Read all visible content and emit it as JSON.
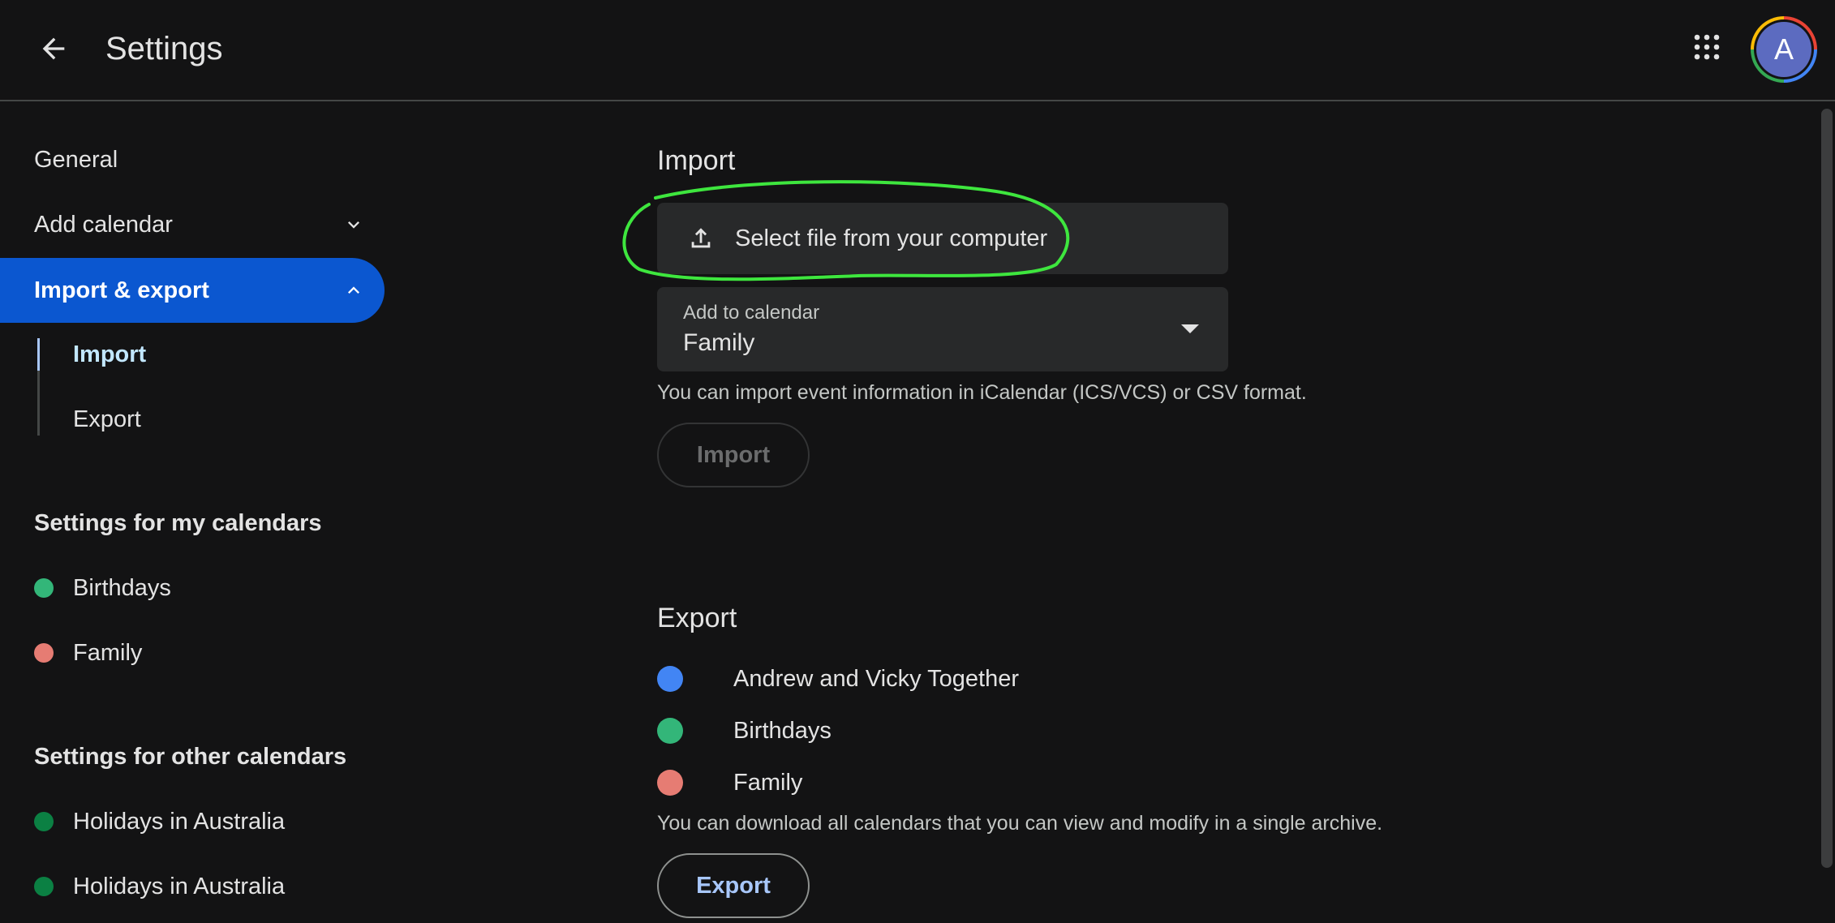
{
  "header": {
    "title": "Settings",
    "avatar_letter": "A"
  },
  "sidebar": {
    "general": "General",
    "add_calendar": "Add calendar",
    "import_export": "Import & export",
    "sub_import": "Import",
    "sub_export": "Export",
    "my_calendars_heading": "Settings for my calendars",
    "my_calendars": [
      {
        "label": "Birthdays",
        "color": "#33b679"
      },
      {
        "label": "Family",
        "color": "#e67c73"
      }
    ],
    "other_calendars_heading": "Settings for other calendars",
    "other_calendars": [
      {
        "label": "Holidays in Australia",
        "color": "#0b8043"
      },
      {
        "label": "Holidays in Australia",
        "color": "#0b8043"
      }
    ]
  },
  "import_section": {
    "heading": "Import",
    "select_file_label": "Select file from your computer",
    "add_to_calendar_label": "Add to calendar",
    "add_to_calendar_value": "Family",
    "helper": "You can import event information in iCalendar (ICS/VCS) or CSV format.",
    "import_button": "Import"
  },
  "export_section": {
    "heading": "Export",
    "calendars": [
      {
        "label": "Andrew and Vicky Together",
        "color": "#4285f4"
      },
      {
        "label": "Birthdays",
        "color": "#33b679"
      },
      {
        "label": "Family",
        "color": "#e67c73"
      }
    ],
    "helper": "You can download all calendars that you can view and modify in a single archive.",
    "export_button": "Export"
  },
  "colors": {
    "accent": "#0b57d0",
    "annotation": "#3ee63e"
  }
}
